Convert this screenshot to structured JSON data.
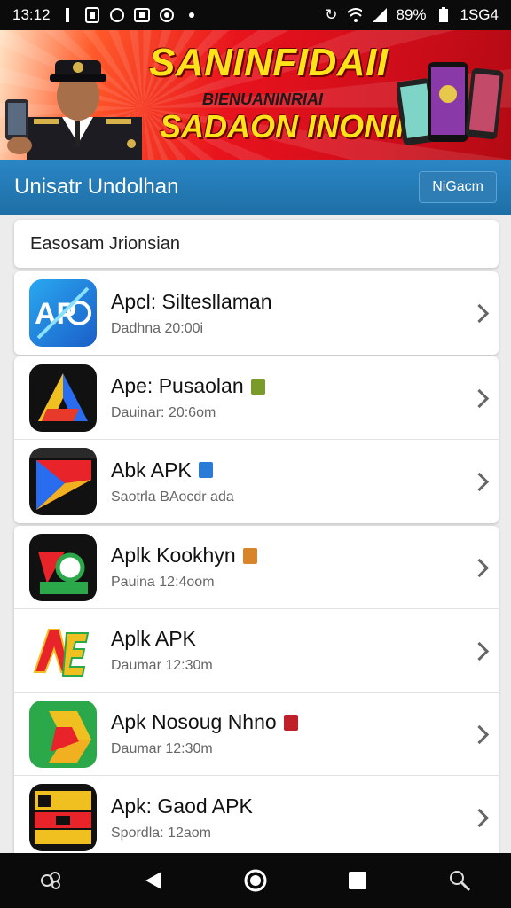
{
  "status_bar": {
    "time": "13:12",
    "left_icons": [
      "notification-icon",
      "sim-icon",
      "circle-icon",
      "image-icon",
      "eye-icon",
      "dot-icon"
    ],
    "sync": "↻",
    "battery_pct": "89%",
    "right_text": "1SG4"
  },
  "banner": {
    "title": "SANINFIDAII",
    "subtitle": "BIENUANINRIAI",
    "tagline": "SADAON INONIN"
  },
  "header": {
    "title": "Unisatr Undolhan",
    "button_label": "NiGacm"
  },
  "search": {
    "placeholder": "Easosam Jrionsian"
  },
  "apps": [
    {
      "name": "Apcl: Siltesllaman",
      "meta": "Dadhna 20:00i",
      "badge": null,
      "icon": "ap-icon"
    },
    {
      "name": "Ape: Pusaolan",
      "meta": "Dauinar: 20:6om",
      "badge": "#7a9a2a",
      "icon": "a-icon-dark"
    },
    {
      "name": "Abk APK",
      "meta": "Saotrla BAocdr ada",
      "badge": "#2a7ad8",
      "icon": "play-icon"
    },
    {
      "name": "Aplk Kookhyn",
      "meta": "Pauina 12:4oom",
      "badge": "#d8842a",
      "icon": "apk-icon"
    },
    {
      "name": "Aplk APK",
      "meta": "Daumar 12:30m",
      "badge": null,
      "icon": "ae-icon"
    },
    {
      "name": "Apk Nosoug Nhno",
      "meta": "Daumar 12:30m",
      "badge": "#c0202a",
      "icon": "drive-icon"
    },
    {
      "name": "Apk: Gaod APK",
      "meta": "Spordla: 12aom",
      "badge": null,
      "icon": "game-icon"
    }
  ],
  "nav": [
    "recents-icon",
    "back-icon",
    "home-icon",
    "overview-icon",
    "search-icon"
  ],
  "colors": {
    "header_blue": "#1f6fa6",
    "banner_red": "#e8131d",
    "banner_yellow": "#ffe21a"
  }
}
